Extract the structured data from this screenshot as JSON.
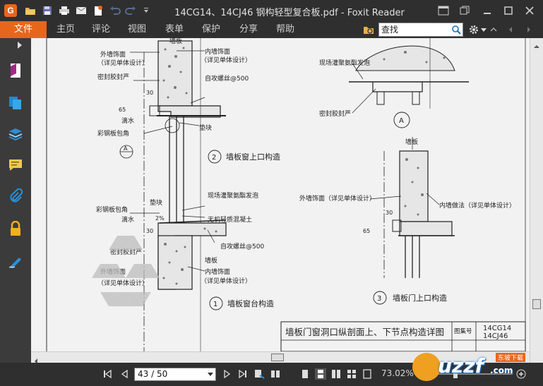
{
  "window": {
    "title": "14CG14、14CJ46 钢构轻型复合板.pdf - Foxit Reader"
  },
  "menu": {
    "file": "文件",
    "items": [
      "主页",
      "评论",
      "视图",
      "表单",
      "保护",
      "分享",
      "帮助"
    ]
  },
  "search": {
    "value": "查找"
  },
  "status": {
    "page_value": "43 / 50",
    "zoom": "73.02%"
  },
  "drawing": {
    "detail1": {
      "labels": {
        "ext_finish": "外墙饰面",
        "ext_finish_note": "（详见单体设计）",
        "sealant": "密封胶封严",
        "drip": "滴水",
        "steel_corner": "彩钢板包角",
        "wall_panel": "墙板",
        "int_finish": "内墙饰面",
        "int_finish_note": "（详见单体设计）",
        "screw": "自攻螺丝@500",
        "spacer": "垫块",
        "dim_30": "30",
        "dim_65": "65",
        "marker": "A"
      },
      "number": "2",
      "title": "墙板窗上口构造"
    },
    "detail2": {
      "labels": {
        "foam": "现场灌聚氨酯发泡",
        "spacer": "垫块",
        "steel_corner": "彩钢板包角",
        "drip": "滴水",
        "inorganic": "无机轻质混凝土",
        "slope": "2%",
        "sealant": "密封胶封严",
        "screw": "自攻螺丝@500",
        "ext_finish": "外墙饰面",
        "ext_finish_note": "（详见单体设计）",
        "wall_panel": "墙板",
        "int_finish": "内墙饰面",
        "int_finish_note": "（详见单体设计）",
        "dim_30": "30"
      },
      "number": "1",
      "title": "墙板窗台构造"
    },
    "detailA": {
      "labels": {
        "foam": "现场灌聚氨酯发泡",
        "sealant": "密封胶封严"
      },
      "marker": "A"
    },
    "detail3": {
      "labels": {
        "wall_panel": "墙板",
        "ext_finish": "外墙饰面（详见单体设计）",
        "int_method": "内墙做法（详见单体设计）",
        "dim_30": "30",
        "dim_65": "65"
      },
      "number": "3",
      "title": "墙板门上口构造"
    },
    "title_block": {
      "title": "墙板门窗洞口纵剖面上、下节点构造详图",
      "atlas_label": "图集号",
      "atlas_no_1": "14CG14",
      "atlas_no_2": "14CJ46"
    }
  },
  "watermark": {
    "text": "uzzf",
    "domain": ".com",
    "sub": "东坡下载"
  },
  "colors": {
    "accent": "#e8661c",
    "chrome": "#2f2f2f",
    "sidebar": "#3b3b3b",
    "page": "#f2f2f2"
  },
  "icons": {
    "titlebar": [
      "app-logo-icon",
      "open-folder-icon",
      "save-icon",
      "print-icon",
      "email-icon",
      "new-icon",
      "undo-icon",
      "redo-icon",
      "customize-quick-access-icon"
    ],
    "sidebar": [
      "expand-panel-icon",
      "page-thumbnail-icon",
      "pages-icon",
      "layers-icon",
      "comment-icon",
      "attachment-icon",
      "security-icon",
      "signature-icon"
    ]
  }
}
